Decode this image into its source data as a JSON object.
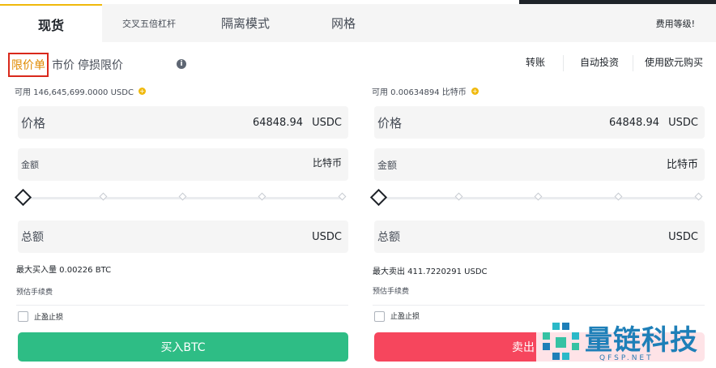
{
  "tabs": [
    {
      "label": "现货"
    },
    {
      "label": "交叉五倍杠杆"
    },
    {
      "label": "隔离模式"
    },
    {
      "label": "网格"
    }
  ],
  "fee_level": "费用等级!",
  "order_types": {
    "limit": "限价单",
    "market": "市价",
    "stop_limit": "停损限价"
  },
  "top_links": {
    "convert": "转账",
    "auto_invest": "自动投资",
    "buy_eur": "使用欧元购买"
  },
  "buy": {
    "available": "可用 146,645,699.0000 USDC",
    "price_label": "价格",
    "price_value": "64848.94",
    "price_unit": "USDC",
    "amount_label": "金额",
    "amount_unit": "比特币",
    "total_label": "总额",
    "total_unit": "USDC",
    "max_line": "最大买入量 0.00226 BTC",
    "fee_label": "预估手续费",
    "tpsl_label": "止盈止损",
    "button": "买入BTC"
  },
  "sell": {
    "available": "可用 0.00634894 比特币",
    "price_label": "价格",
    "price_value": "64848.94",
    "price_unit": "USDC",
    "amount_label": "金额",
    "amount_unit": "比特币",
    "total_label": "总额",
    "total_unit": "USDC",
    "max_line": "最大卖出 411.7220291 USDC",
    "fee_label": "预估手续费",
    "tpsl_label": "止盈止损",
    "button": "卖出"
  },
  "watermark": {
    "text": "量链科技",
    "sub": "QFSP.NET"
  },
  "colors": {
    "accent": "#f0b90b",
    "buy": "#2ebd85",
    "sell": "#f6465d",
    "highlight": "#d9291c"
  }
}
